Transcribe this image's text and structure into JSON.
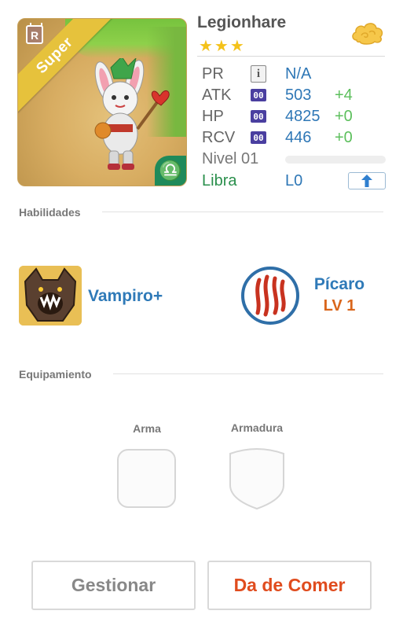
{
  "hero": {
    "name": "Legionhare",
    "stars": "★★★",
    "rarity_badge": "R",
    "ribbon_label": "Super",
    "zodiac_symbol": "♎"
  },
  "stats": {
    "pr": {
      "label": "PR",
      "value": "N/A"
    },
    "atk": {
      "label": "ATK",
      "icon_text": "00",
      "value": "503",
      "bonus": "+4"
    },
    "hp": {
      "label": "HP",
      "icon_text": "00",
      "value": "4825",
      "bonus": "+0"
    },
    "rcv": {
      "label": "RCV",
      "icon_text": "00",
      "value": "446",
      "bonus": "+0"
    },
    "level": {
      "label": "Nivel 01",
      "xp_fraction": 0.0
    },
    "sign": {
      "label": "Libra",
      "level": "L0"
    }
  },
  "abilities": {
    "title": "Habilidades",
    "leader_name": "Vampiro+",
    "skill_name": "Pícaro",
    "skill_level": "LV 1"
  },
  "equipment": {
    "title": "Equipamiento",
    "weapon_label": "Arma",
    "armor_label": "Armadura"
  },
  "actions": {
    "manage_label": "Gestionar",
    "feed_label": "Da de Comer"
  },
  "colors": {
    "blue_value": "#2e77b6",
    "green_bonus": "#5cbf5c",
    "orange_level": "#d9661c",
    "feed_red": "#e04c1e",
    "star_gold": "#f4c21a",
    "ribbon_gold": "#e6c23c"
  },
  "icons": {
    "cloud": "cloud-icon",
    "info": "info-icon",
    "upgrade": "arrow-up-icon",
    "zodiac": "libra-icon",
    "leader": "werewolf-icon",
    "skill": "claw-icon"
  }
}
